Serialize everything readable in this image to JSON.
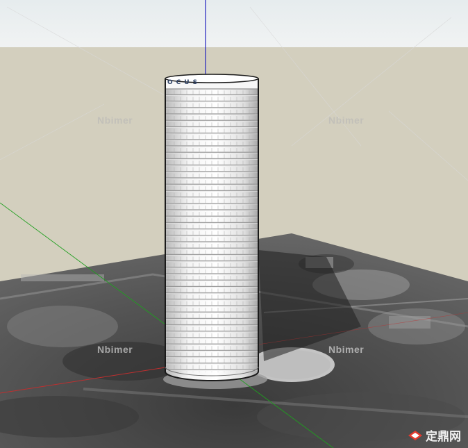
{
  "scene": {
    "sky_color": "#e9eef0",
    "ground_color": "#d4cfbd",
    "building_sign": "OCUS",
    "axis_colors": {
      "blue": "#1f1fbf",
      "green": "#1f9f1f",
      "red": "#bf2f2f"
    }
  },
  "watermarks": {
    "top_left": "Nbimer",
    "top_right": "Nbimer",
    "bottom_left": "Nbimer",
    "bottom_right": "Nbimer"
  },
  "site_label": "定鼎网",
  "icons": {
    "site_logo": "diamond-logo-icon"
  }
}
